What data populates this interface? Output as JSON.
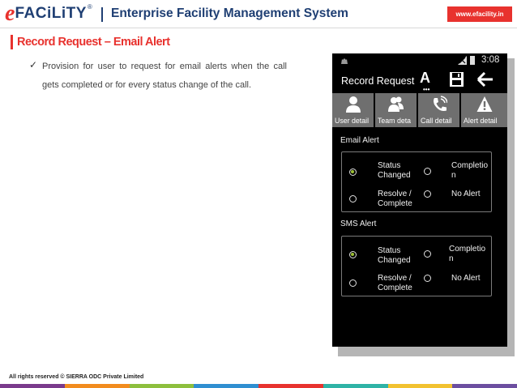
{
  "header": {
    "logo_e": "e",
    "logo_rest": "FACiLiTY",
    "logo_reg": "®",
    "title": "Enterprise Facility Management System",
    "website": "www.efacility.in"
  },
  "slide": {
    "title": "Record Request – Email Alert",
    "bullet_mark": "✓",
    "description": "Provision for user to request for email alerts when the call gets completed or for every status change of the call."
  },
  "phone": {
    "status_bar": {
      "time": "3:08",
      "left_icon": "android-notification-icon"
    },
    "action_bar": {
      "title": "Record Request",
      "icons": [
        "font-size-icon",
        "save-icon",
        "back-arrow-icon"
      ],
      "font_icon_letter": "A",
      "font_icon_dots": "•••"
    },
    "tabs": [
      {
        "label": "User detail",
        "icon": "user-icon"
      },
      {
        "label": "Team deta",
        "icon": "team-icon"
      },
      {
        "label": "Call detail",
        "icon": "phone-icon"
      },
      {
        "label": "Alert detail",
        "icon": "warning-icon"
      }
    ],
    "email_alert": {
      "label": "Email Alert",
      "options": [
        {
          "label": "Status\nChanged",
          "selected": true
        },
        {
          "label": "Completio\nn",
          "selected": false
        },
        {
          "label": "Resolve /\nComplete",
          "selected": false
        },
        {
          "label": "No Alert",
          "selected": false
        }
      ]
    },
    "sms_alert": {
      "label": "SMS Alert",
      "options": [
        {
          "label": "Status\nChanged",
          "selected": true
        },
        {
          "label": "Completio\nn",
          "selected": false
        },
        {
          "label": "Resolve /\nComplete",
          "selected": false
        },
        {
          "label": "No Alert",
          "selected": false
        }
      ]
    }
  },
  "footer": {
    "copyright": "All rights reserved © SIERRA ODC Private Limited",
    "stripe_colors": [
      "#7a3a8c",
      "#f28c1e",
      "#8dbf3d",
      "#2f8fd1",
      "#e8322e",
      "#2eb3a6",
      "#f2c230",
      "#6c4ea0"
    ]
  },
  "colors": {
    "brand_red": "#e8322e",
    "brand_navy": "#1f3f73",
    "radio_selected": "#9dc134",
    "tab_bg": "#6f6f6f"
  }
}
